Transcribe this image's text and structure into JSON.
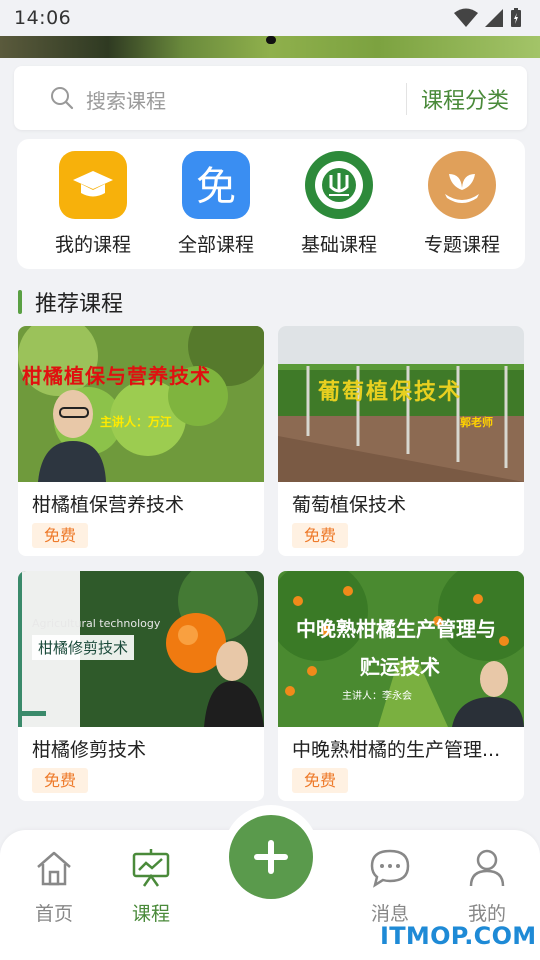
{
  "status_bar": {
    "time": "14:06",
    "icons": [
      "wifi-icon",
      "signal-icon",
      "battery-icon"
    ]
  },
  "search": {
    "placeholder": "搜索课程",
    "category_label": "课程分类"
  },
  "quick_nav": [
    {
      "label": "我的课程",
      "icon": "graduation-cap-icon",
      "color": "#f7b10b"
    },
    {
      "label": "全部课程",
      "icon": "free-badge-icon",
      "color": "#3a8ef2"
    },
    {
      "label": "基础课程",
      "icon": "lianong-logo-icon",
      "color": "#2d8a3a"
    },
    {
      "label": "专题课程",
      "icon": "sprout-hand-icon",
      "color": "#e0a05a"
    }
  ],
  "section": {
    "title": "推荐课程"
  },
  "courses": [
    {
      "title": "柑橘植保营养技术",
      "price": "免费",
      "thumb_caption": "柑橘植保与营养技术",
      "thumb_sub": "主讲人：万江"
    },
    {
      "title": "葡萄植保技术",
      "price": "免费",
      "thumb_caption": "葡萄植保技术",
      "thumb_sub": "郭老师"
    },
    {
      "title": "柑橘修剪技术",
      "price": "免费",
      "thumb_caption": "柑橘修剪技术",
      "thumb_sub": "Agricultural technology"
    },
    {
      "title": "中晚熟柑橘的生产管理...",
      "price": "免费",
      "thumb_caption": "中晚熟柑橘生产管理与",
      "thumb_caption2": "贮运技术",
      "thumb_sub": "主讲人：李永会"
    }
  ],
  "tabbar": {
    "items": [
      {
        "label": "首页",
        "icon": "home-icon",
        "active": false
      },
      {
        "label": "课程",
        "icon": "presentation-icon",
        "active": true
      },
      {
        "label": "消息",
        "icon": "message-icon",
        "active": false
      },
      {
        "label": "我的",
        "icon": "user-icon",
        "active": false
      }
    ],
    "fab_icon": "plus-icon"
  },
  "colors": {
    "accent": "#4a8a3a",
    "fab": "#5a9a4c",
    "price": "#ee7a2a",
    "price_bg": "#fff1e2"
  },
  "watermark": "ITMOP.COM"
}
